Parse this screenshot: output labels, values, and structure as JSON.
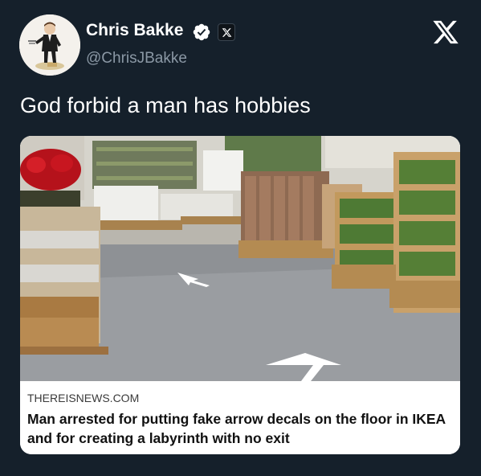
{
  "author": {
    "display_name": "Chris Bakke",
    "handle": "@ChrisJBakke",
    "verified_icon": "verified-badge-icon",
    "affiliation_icon": "x-badge-icon"
  },
  "header": {
    "close_icon": "x-logo-icon"
  },
  "tweet": {
    "text": "God forbid a man has hobbies"
  },
  "link_card": {
    "domain": "THEREISNEWS.COM",
    "title": "Man arrested for putting fake arrow decals on the floor in IKEA and for creating a labyrinth with no exit",
    "image_description_icon": "store-aisle-photo"
  },
  "colors": {
    "background": "#15202b",
    "text_primary": "#ffffff",
    "text_secondary": "#8b98a5",
    "card_background": "#ffffff"
  }
}
